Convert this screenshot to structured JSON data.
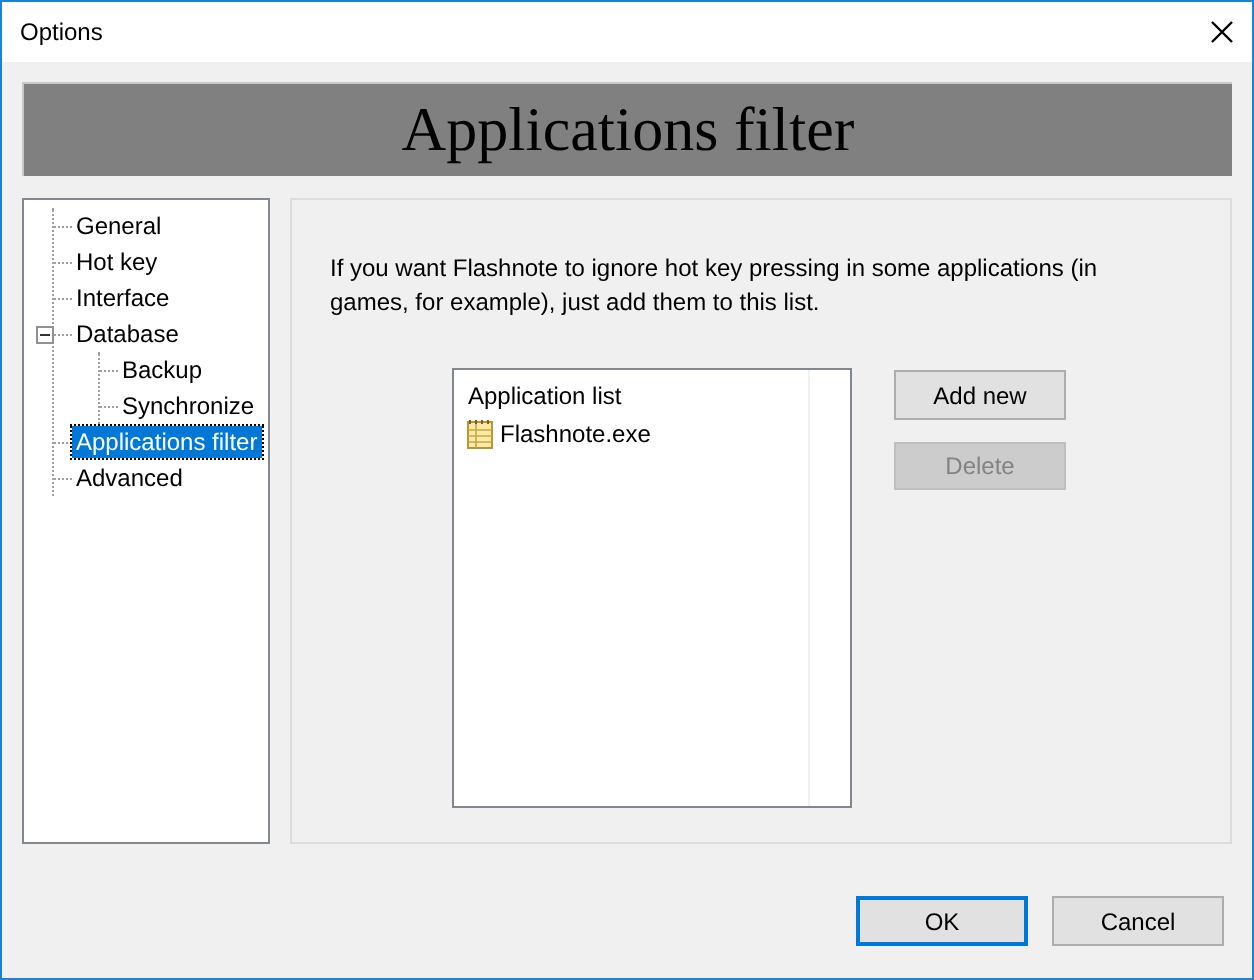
{
  "window": {
    "title": "Options"
  },
  "header": {
    "title": "Applications filter"
  },
  "tree": [
    {
      "label": "General",
      "selected": false
    },
    {
      "label": "Hot key",
      "selected": false
    },
    {
      "label": "Interface",
      "selected": false
    },
    {
      "label": "Database",
      "selected": false,
      "expanded": true,
      "children": [
        {
          "label": "Backup",
          "selected": false
        },
        {
          "label": "Synchronize",
          "selected": false
        }
      ]
    },
    {
      "label": "Applications filter",
      "selected": true
    },
    {
      "label": "Advanced",
      "selected": false
    }
  ],
  "description": "If you want Flashnote to ignore hot key pressing in some applications (in games, for example), just add them to this list.",
  "app_list": {
    "header": "Application list",
    "items": [
      "Flashnote.exe"
    ]
  },
  "list_buttons": [
    {
      "label": "Add new",
      "disabled": false
    },
    {
      "label": "Delete",
      "disabled": true
    }
  ],
  "dialog_buttons": [
    {
      "label": "OK",
      "default": true
    },
    {
      "label": "Cancel",
      "default": false
    }
  ]
}
